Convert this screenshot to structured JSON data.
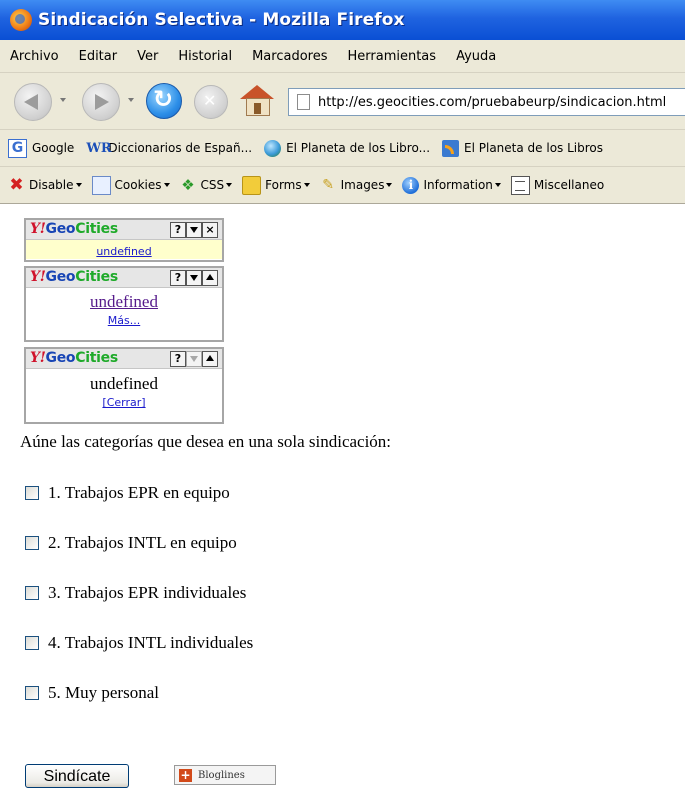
{
  "window": {
    "title": "Sindicación Selectiva - Mozilla Firefox"
  },
  "menu": [
    "Archivo",
    "Editar",
    "Ver",
    "Historial",
    "Marcadores",
    "Herramientas",
    "Ayuda"
  ],
  "navbar": {
    "url": "http://es.geocities.com/pruebabeurp/sindicacion.html"
  },
  "bookmarks": [
    {
      "label": "Google",
      "icon": "google-icon"
    },
    {
      "label": "Diccionarios de Españ...",
      "icon": "wordreference-icon"
    },
    {
      "label": "El Planeta de los Libro...",
      "icon": "globe-icon"
    },
    {
      "label": "El Planeta de los Libros",
      "icon": "rss-icon"
    }
  ],
  "devtoolbar": [
    {
      "label": "Disable",
      "icon": "disable-icon"
    },
    {
      "label": "Cookies",
      "icon": "cookie-icon"
    },
    {
      "label": "CSS",
      "icon": "css-icon"
    },
    {
      "label": "Forms",
      "icon": "forms-icon"
    },
    {
      "label": "Images",
      "icon": "images-icon"
    },
    {
      "label": "Information",
      "icon": "information-icon"
    },
    {
      "label": "Miscellaneo",
      "icon": "miscellaneous-icon"
    }
  ],
  "widgets": {
    "logo_y": "Y!",
    "logo_geo": "Geo",
    "logo_cities": "Cities",
    "help": "?",
    "close": "×",
    "w1_text": "undefined",
    "w2_text": "undefined",
    "w2_more": "Más...",
    "w3_text": "undefined",
    "w3_close": "[Cerrar]"
  },
  "page": {
    "intro": "Aúne las categorías que desea en una sola sindicación:",
    "options": [
      {
        "label": "1. Trabajos EPR en equipo",
        "checked": false
      },
      {
        "label": "2. Trabajos INTL en equipo",
        "checked": false
      },
      {
        "label": "3. Trabajos EPR individuales",
        "checked": false
      },
      {
        "label": "4. Trabajos INTL individuales",
        "checked": false
      },
      {
        "label": "5. Muy personal",
        "checked": false
      }
    ],
    "submit_label": "Sindícate",
    "bloglines_label": "Bloglines"
  }
}
